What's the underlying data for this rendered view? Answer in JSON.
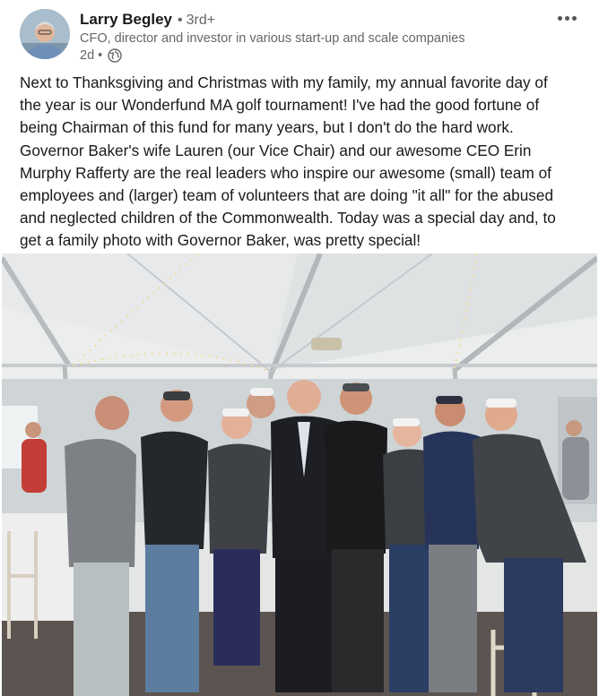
{
  "post": {
    "author": {
      "name": "Larry Begley",
      "separator": "•",
      "degree": "3rd+",
      "headline": "CFO, director and investor in various start-up and scale companies",
      "avatar_icon": "profile-photo"
    },
    "meta": {
      "time": "2d",
      "separator": "•",
      "visibility_icon": "globe-icon"
    },
    "more_icon": "ellipsis-icon",
    "body": "Next to Thanksgiving and Christmas with my family, my annual favorite day of\nthe year is our Wonderfund MA golf tournament! I've had the good fortune of\nbeing Chairman of this fund for many years, but I don't do the hard work.\nGovernor Baker's wife Lauren (our Vice Chair) and our awesome CEO Erin\nMurphy Rafferty are the real leaders who inspire our awesome (small) team of\nemployees and (larger) team of volunteers that are doing \"it all\" for the abused\nand neglected children of the Commonwealth. Today was a special day and, to\nget a family photo with Governor Baker, was pretty special!",
    "image": {
      "subject": "group-photo-under-event-tent",
      "people_count": 10
    }
  },
  "colors": {
    "name": "#191919",
    "secondary": "#666666",
    "body": "#191919"
  }
}
